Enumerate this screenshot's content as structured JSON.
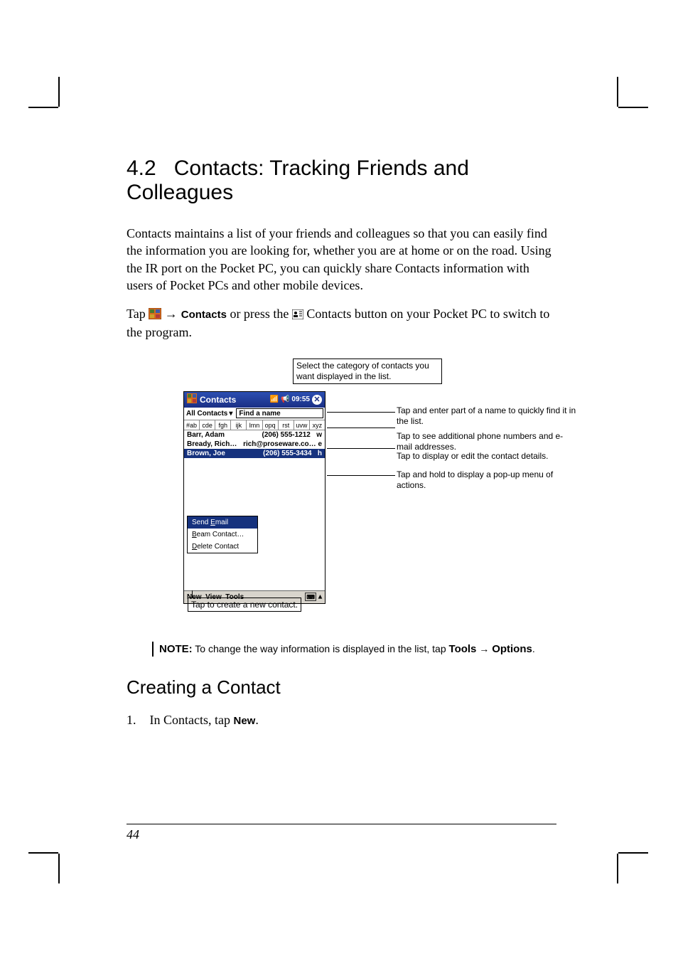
{
  "section": {
    "number": "4.2",
    "title": "Contacts: Tracking Friends and Colleagues"
  },
  "para1": "Contacts maintains a list of your friends and colleagues so that you can easily find the information you are looking for, whether you are at home or on the road. Using the IR port on the Pocket PC, you can quickly share Contacts information with users of Pocket PCs and other mobile devices.",
  "para2": {
    "pre": "Tap ",
    "arrow1": " → ",
    "contacts": "Contacts",
    "mid": " or press the ",
    "post": " Contacts button on your Pocket PC to switch to the program."
  },
  "callouts": {
    "top": "Select the category of contacts you want displayed in the list.",
    "find": "Tap and enter part of a name to quickly find it in the list.",
    "expand": "Tap to see additional phone numbers and e-mail addresses.",
    "details": "Tap to display or edit the contact details.",
    "popup": "Tap and hold to display a pop-up menu of actions.",
    "bottom": "Tap to create a new contact."
  },
  "ppc": {
    "title": "Contacts",
    "time": "09:55",
    "filter_label": "All Contacts",
    "find_placeholder": "Find a name",
    "alpha": [
      "#ab",
      "cde",
      "fgh",
      "ijk",
      "lmn",
      "opq",
      "rst",
      "uvw",
      "xyz"
    ],
    "rows": [
      {
        "name": "Barr, Adam",
        "value": "(206) 555-1212",
        "tag": "w"
      },
      {
        "name": "Bready, Rich…",
        "value": "rich@proseware.co…",
        "tag": "e"
      },
      {
        "name": "Brown, Joe",
        "value": "(206) 555-3434",
        "tag": "h"
      }
    ],
    "popup": {
      "items": [
        "Send Email",
        "Beam Contact…",
        "Delete Contact"
      ],
      "underline_indices": [
        5,
        0,
        0
      ]
    },
    "menus": [
      "New",
      "View",
      "Tools"
    ]
  },
  "note": {
    "prefix": "NOTE:",
    "body_pre": " To change the way information is displayed in the list, tap ",
    "tools": "Tools",
    "arrow": " → ",
    "options": "Options",
    "body_post": "."
  },
  "subsection": {
    "title": "Creating a Contact"
  },
  "step1": {
    "num": "1.",
    "pre": "In Contacts, tap ",
    "new": "New",
    "post": "."
  },
  "page_number": "44"
}
